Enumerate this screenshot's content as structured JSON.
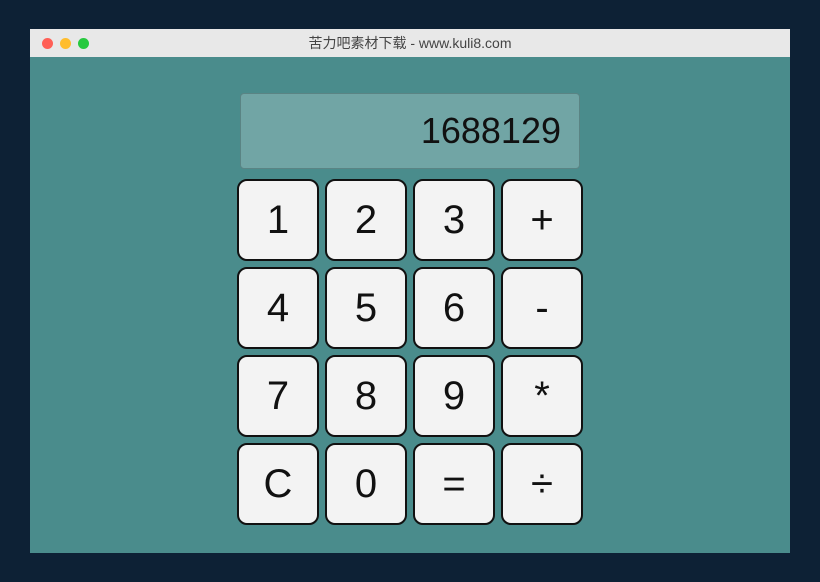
{
  "window": {
    "title": "苦力吧素材下载 - www.kuli8.com"
  },
  "calculator": {
    "display": "1688129",
    "keys": {
      "r0c0": "1",
      "r0c1": "2",
      "r0c2": "3",
      "r0c3": "+",
      "r1c0": "4",
      "r1c1": "5",
      "r1c2": "6",
      "r1c3": "-",
      "r2c0": "7",
      "r2c1": "8",
      "r2c2": "9",
      "r2c3": "*",
      "r3c0": "C",
      "r3c1": "0",
      "r3c2": "=",
      "r3c3": "÷"
    }
  }
}
